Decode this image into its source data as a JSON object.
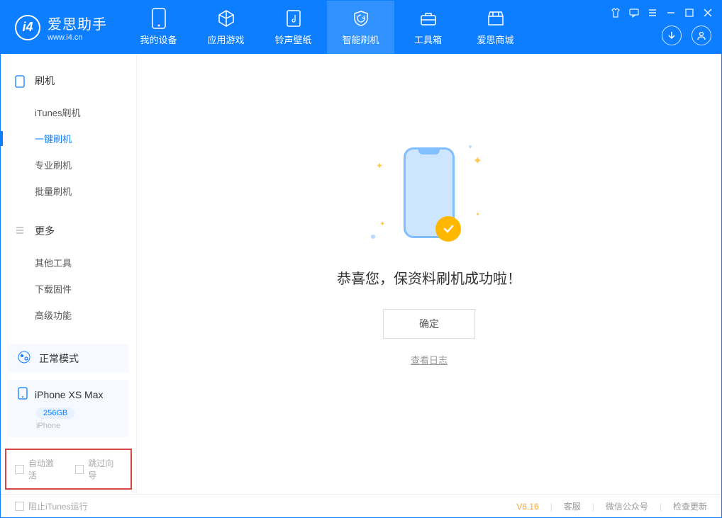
{
  "app": {
    "title": "爱思助手",
    "url": "www.i4.cn",
    "logo_letter": "i4"
  },
  "nav": [
    {
      "label": "我的设备"
    },
    {
      "label": "应用游戏"
    },
    {
      "label": "铃声壁纸"
    },
    {
      "label": "智能刷机"
    },
    {
      "label": "工具箱"
    },
    {
      "label": "爱思商城"
    }
  ],
  "sidebar": {
    "section1_title": "刷机",
    "items1": [
      {
        "label": "iTunes刷机"
      },
      {
        "label": "一键刷机"
      },
      {
        "label": "专业刷机"
      },
      {
        "label": "批量刷机"
      }
    ],
    "section2_title": "更多",
    "items2": [
      {
        "label": "其他工具"
      },
      {
        "label": "下载固件"
      },
      {
        "label": "高级功能"
      }
    ]
  },
  "mode": {
    "label": "正常模式"
  },
  "device": {
    "name": "iPhone XS Max",
    "storage": "256GB",
    "type": "iPhone"
  },
  "checkboxes": {
    "auto_activate": "自动激活",
    "skip_guide": "跳过向导"
  },
  "main": {
    "success_message": "恭喜您，保资料刷机成功啦！",
    "confirm_label": "确定",
    "log_link": "查看日志"
  },
  "footer": {
    "stop_itunes": "阻止iTunes运行",
    "version": "V8.16",
    "support": "客服",
    "wechat": "微信公众号",
    "check_update": "检查更新"
  }
}
